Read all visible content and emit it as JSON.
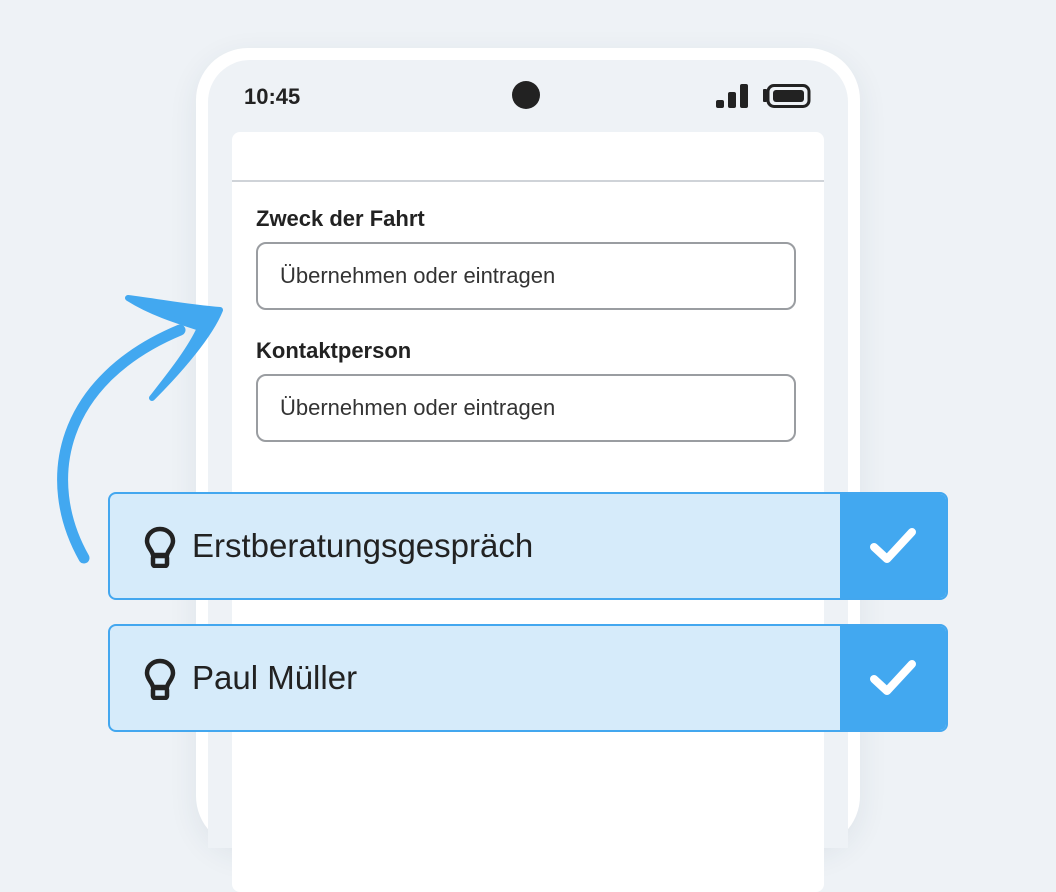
{
  "status_bar": {
    "time": "10:45",
    "icons": [
      "camera-icon",
      "signal-icon",
      "battery-icon"
    ]
  },
  "form": {
    "fields": [
      {
        "label": "Zweck der Fahrt",
        "value": "",
        "placeholder": "Übernehmen oder eintragen"
      },
      {
        "label": "Kontaktperson",
        "value": "",
        "placeholder": "Übernehmen oder eintragen"
      }
    ]
  },
  "suggestions": [
    {
      "text": "Erstberatungsgespräch",
      "icon": "lightbulb-icon",
      "action_icon": "checkmark-icon"
    },
    {
      "text": "Paul Müller",
      "icon": "lightbulb-icon",
      "action_icon": "checkmark-icon"
    }
  ],
  "colors": {
    "background": "#eef2f6",
    "accent": "#42a8f0",
    "suggestion_bg": "#d6ebfa",
    "text": "#222222"
  },
  "decoration": {
    "arrow_icon": "curved-arrow-icon"
  }
}
